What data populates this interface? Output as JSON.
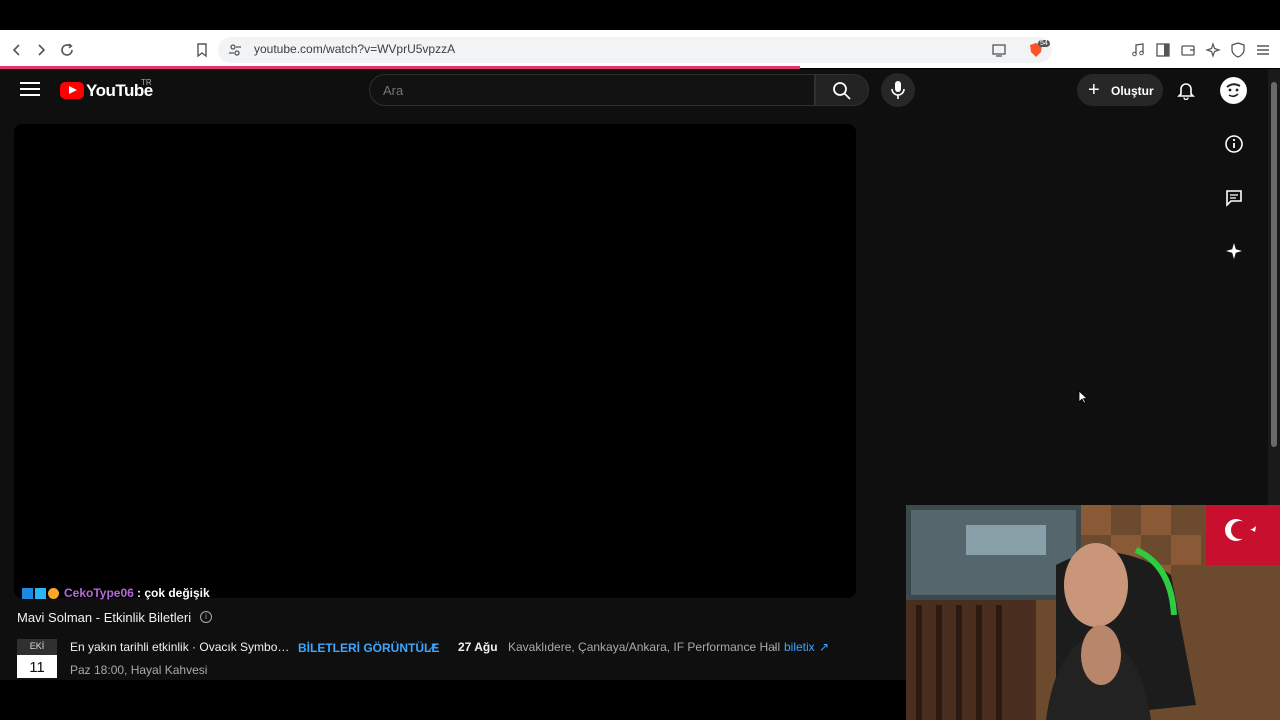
{
  "browser": {
    "url": "youtube.com/watch?v=WVprU5vpzzA",
    "brave_badge": "54"
  },
  "header": {
    "logo_text": "YouTube",
    "country": "TR",
    "search_placeholder": "Ara",
    "create_label": "Oluştur"
  },
  "video": {
    "chat_user": "CekoType06",
    "chat_message": ": çok değişik",
    "title": "Mavi Solman - Etkinlik Biletleri"
  },
  "event": {
    "month": "EKİ",
    "day": "11",
    "name": "En yakın tarihli etkinlik · Ovacık Symbol Ya...",
    "time": "Paz 18:00, Hayal Kahvesi",
    "tickets_label": "BİLETLERİ GÖRÜNTÜLE",
    "second_date": "27 Ağu",
    "venue": "Kavaklıdere, Çankaya/Ankara, IF Performance Hall",
    "separator": "·",
    "provider": "biletix"
  },
  "colors": {
    "accent_red": "#ff0000",
    "link_blue": "#3ea6ff",
    "background": "#0f0f0f",
    "chat_user": "#b46bd6"
  }
}
